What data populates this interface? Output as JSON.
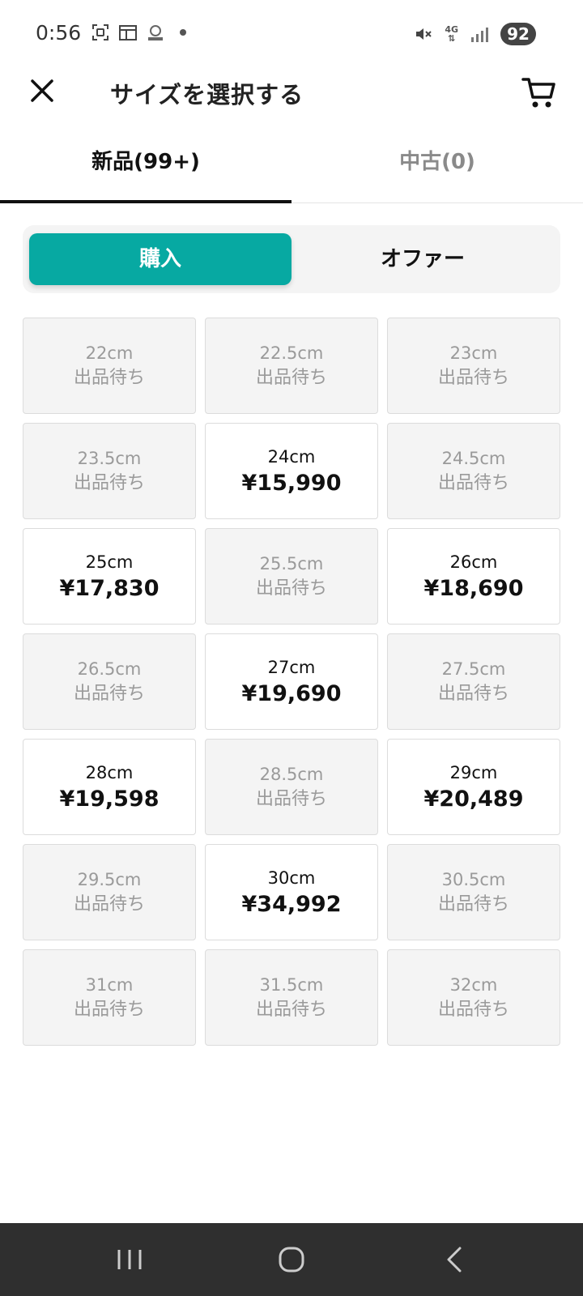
{
  "status_bar": {
    "time": "0:56",
    "network": "4G",
    "battery": "92",
    "left_icons": [
      "screenshot-icon",
      "calendar-icon",
      "app-icon"
    ],
    "right_icons": [
      "mute-icon",
      "signal-icon"
    ]
  },
  "header": {
    "title": "サイズを選択する",
    "close_icon": "close-icon",
    "cart_icon": "cart-icon"
  },
  "tabs": [
    {
      "label": "新品(99+)",
      "active": true
    },
    {
      "label": "中古(0)",
      "active": false
    }
  ],
  "segment": {
    "buy_label": "購入",
    "offer_label": "オファー",
    "accent_color": "#07a9a2"
  },
  "sizes": [
    {
      "size": "22cm",
      "status": "出品待ち",
      "price": null
    },
    {
      "size": "22.5cm",
      "status": "出品待ち",
      "price": null
    },
    {
      "size": "23cm",
      "status": "出品待ち",
      "price": null
    },
    {
      "size": "23.5cm",
      "status": "出品待ち",
      "price": null
    },
    {
      "size": "24cm",
      "status": null,
      "price": "¥15,990"
    },
    {
      "size": "24.5cm",
      "status": "出品待ち",
      "price": null
    },
    {
      "size": "25cm",
      "status": null,
      "price": "¥17,830"
    },
    {
      "size": "25.5cm",
      "status": "出品待ち",
      "price": null
    },
    {
      "size": "26cm",
      "status": null,
      "price": "¥18,690"
    },
    {
      "size": "26.5cm",
      "status": "出品待ち",
      "price": null
    },
    {
      "size": "27cm",
      "status": null,
      "price": "¥19,690"
    },
    {
      "size": "27.5cm",
      "status": "出品待ち",
      "price": null
    },
    {
      "size": "28cm",
      "status": null,
      "price": "¥19,598"
    },
    {
      "size": "28.5cm",
      "status": "出品待ち",
      "price": null
    },
    {
      "size": "29cm",
      "status": null,
      "price": "¥20,489"
    },
    {
      "size": "29.5cm",
      "status": "出品待ち",
      "price": null
    },
    {
      "size": "30cm",
      "status": null,
      "price": "¥34,992"
    },
    {
      "size": "30.5cm",
      "status": "出品待ち",
      "price": null
    },
    {
      "size": "31cm",
      "status": "出品待ち",
      "price": null
    },
    {
      "size": "31.5cm",
      "status": "出品待ち",
      "price": null
    },
    {
      "size": "32cm",
      "status": "出品待ち",
      "price": null
    }
  ],
  "nav_bar": {
    "icons": [
      "recent-apps-icon",
      "home-icon",
      "back-icon"
    ]
  }
}
